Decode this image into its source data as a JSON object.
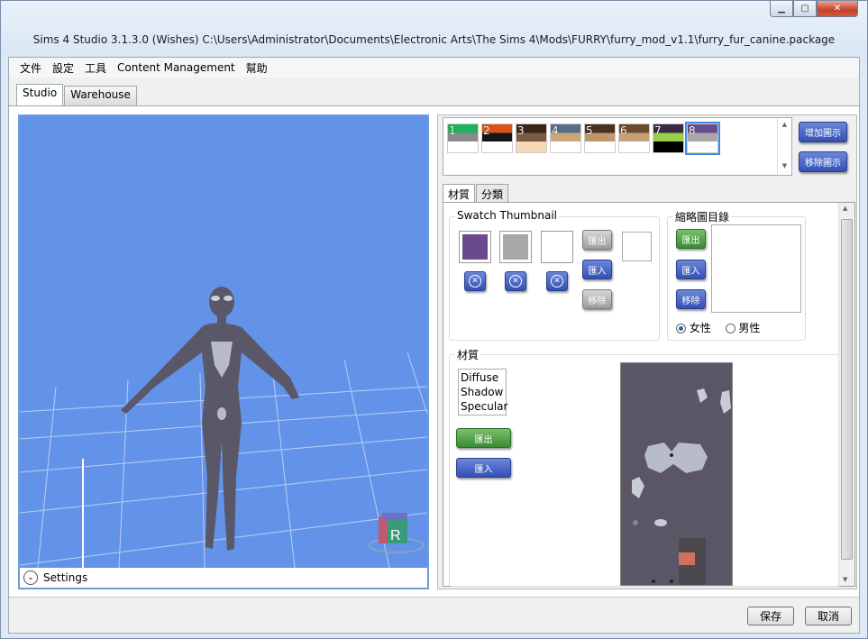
{
  "window": {
    "title": "Sims 4 Studio 3.1.3.0 (Wishes)  C:\\Users\\Administrator\\Documents\\Electronic Arts\\The Sims 4\\Mods\\FURRY\\furry_mod_v1.1\\furry_fur_canine.package",
    "minimize": "▁",
    "maximize": "▢",
    "close": "✕"
  },
  "menu": [
    "文件",
    "設定",
    "工具",
    "Content Management",
    "幫助"
  ],
  "main_tabs": [
    "Studio",
    "Warehouse"
  ],
  "viewport": {
    "settings_label": "Settings",
    "cube_letter": "R"
  },
  "swatches": [
    {
      "num": "1",
      "top": "#1fb25a",
      "mid": "#8a8a8a",
      "bottom": "#ffffff"
    },
    {
      "num": "2",
      "top": "#d9541a",
      "mid": "#151515",
      "bottom": "#ffffff"
    },
    {
      "num": "3",
      "top": "#3a2618",
      "mid": "#7a5a42",
      "bottom": "#f5d8b8"
    },
    {
      "num": "4",
      "top": "#5a6c88",
      "mid": "#cda57a",
      "bottom": "#ffffff"
    },
    {
      "num": "5",
      "top": "#4a3020",
      "mid": "#c0966a",
      "bottom": "#ffffff"
    },
    {
      "num": "6",
      "top": "#6a4a2c",
      "mid": "#c8a078",
      "bottom": "#ffffff"
    },
    {
      "num": "7",
      "top": "#3a2a40",
      "mid": "#9ad048",
      "bottom": "#000000"
    },
    {
      "num": "8",
      "top": "#6a4a8c",
      "mid": "#a8a8a8",
      "bottom": "#ffffff"
    }
  ],
  "swatch_buttons": {
    "add": "增加圖示",
    "remove": "移除圖示"
  },
  "sub_tabs": [
    "材質",
    "分類"
  ],
  "swatch_thumbnail": {
    "label": "Swatch Thumbnail",
    "colors": [
      "#6a4a8c",
      "#a8a8a8",
      "#ffffff"
    ],
    "export": "匯出",
    "import": "匯入",
    "remove": "移除"
  },
  "thumbnail_catalog": {
    "label": "縮略圖目錄",
    "export": "匯出",
    "import": "匯入",
    "remove": "移除",
    "female": "女性",
    "male": "男性"
  },
  "material": {
    "label": "材質",
    "items": [
      "Diffuse",
      "Shadow",
      "Specular"
    ],
    "export": "匯出",
    "import": "匯入"
  },
  "dialog": {
    "save": "保存",
    "cancel": "取消"
  }
}
